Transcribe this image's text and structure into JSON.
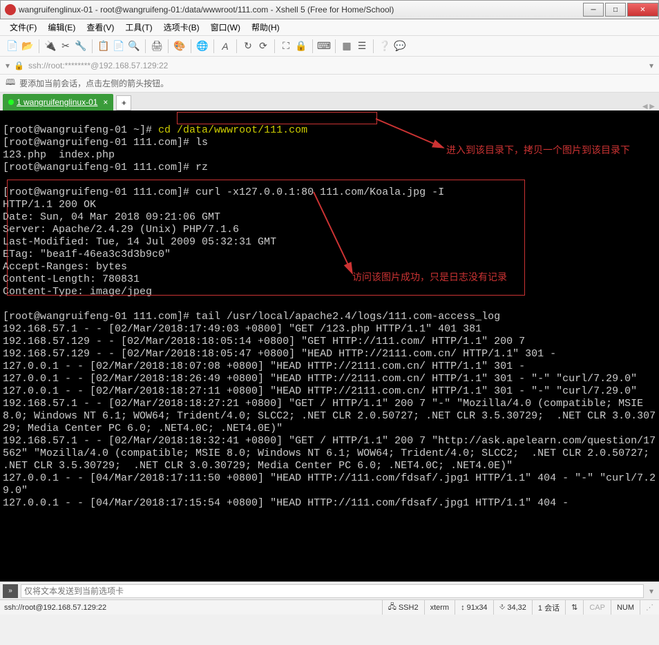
{
  "window": {
    "title": "wangruifenglinux-01 - root@wangruifeng-01:/data/wwwroot/111.com - Xshell 5 (Free for Home/School)"
  },
  "menu": {
    "file": "文件(F)",
    "edit": "编辑(E)",
    "view": "查看(V)",
    "tools": "工具(T)",
    "tabs": "选项卡(B)",
    "window": "窗口(W)",
    "help": "帮助(H)"
  },
  "address": {
    "value": "ssh://root:********@192.168.57.129:22"
  },
  "hint": "要添加当前会话，点击左侧的箭头按钮。",
  "tab": {
    "label": "1 wangruifenglinux-01"
  },
  "term": {
    "l1a": "[root@wangruifeng-01 ~]# ",
    "l1b": "cd /data/wwwroot/111.com",
    "l2": "[root@wangruifeng-01 111.com]# ls",
    "l3": "123.php  index.php",
    "l4": "[root@wangruifeng-01 111.com]# rz",
    "blank": "",
    "l6": "[root@wangruifeng-01 111.com]# curl -x127.0.0.1:80 111.com/Koala.jpg -I",
    "l7": "HTTP/1.1 200 OK",
    "l8": "Date: Sun, 04 Mar 2018 09:21:06 GMT",
    "l9": "Server: Apache/2.4.29 (Unix) PHP/7.1.6",
    "l10": "Last-Modified: Tue, 14 Jul 2009 05:32:31 GMT",
    "l11": "ETag: \"bea1f-46ea3c3d3b9c0\"",
    "l12": "Accept-Ranges: bytes",
    "l13": "Content-Length: 780831",
    "l14": "Content-Type: image/jpeg",
    "l16": "[root@wangruifeng-01 111.com]# tail /usr/local/apache2.4/logs/111.com-access_log",
    "l17": "192.168.57.1 - - [02/Mar/2018:17:49:03 +0800] \"GET /123.php HTTP/1.1\" 401 381",
    "l18": "192.168.57.129 - - [02/Mar/2018:18:05:14 +0800] \"GET HTTP://111.com/ HTTP/1.1\" 200 7",
    "l19": "192.168.57.129 - - [02/Mar/2018:18:05:47 +0800] \"HEAD HTTP://2111.com.cn/ HTTP/1.1\" 301 -",
    "l20": "127.0.0.1 - - [02/Mar/2018:18:07:08 +0800] \"HEAD HTTP://2111.com.cn/ HTTP/1.1\" 301 -",
    "l21": "127.0.0.1 - - [02/Mar/2018:18:26:49 +0800] \"HEAD HTTP://2111.com.cn/ HTTP/1.1\" 301 - \"-\" \"curl/7.29.0\"",
    "l22": "127.0.0.1 - - [02/Mar/2018:18:27:11 +0800] \"HEAD HTTP://2111.com.cn/ HTTP/1.1\" 301 - \"-\" \"curl/7.29.0\"",
    "l23": "192.168.57.1 - - [02/Mar/2018:18:27:21 +0800] \"GET / HTTP/1.1\" 200 7 \"-\" \"Mozilla/4.0 (compatible; MSIE 8.0; Windows NT 6.1; WOW64; Trident/4.0; SLCC2; .NET CLR 2.0.50727; .NET CLR 3.5.30729;  .NET CLR 3.0.30729; Media Center PC 6.0; .NET4.0C; .NET4.0E)\"",
    "l24": "192.168.57.1 - - [02/Mar/2018:18:32:41 +0800] \"GET / HTTP/1.1\" 200 7 \"http://ask.apelearn.com/question/17562\" \"Mozilla/4.0 (compatible; MSIE 8.0; Windows NT 6.1; WOW64; Trident/4.0; SLCC2;  .NET CLR 2.0.50727; .NET CLR 3.5.30729;  .NET CLR 3.0.30729; Media Center PC 6.0; .NET4.0C; .NET4.0E)\"",
    "l25": "127.0.0.1 - - [04/Mar/2018:17:11:50 +0800] \"HEAD HTTP://111.com/fdsaf/.jpg1 HTTP/1.1\" 404 - \"-\" \"curl/7.29.0\"",
    "l26": "127.0.0.1 - - [04/Mar/2018:17:15:54 +0800] \"HEAD HTTP://111.com/fdsaf/.jpg1 HTTP/1.1\" 404 -"
  },
  "annot": {
    "a1": "进入到该目录下，拷贝一个图片到该目录下",
    "a2": "访问该图片成功，只是日志没有记录"
  },
  "sendbar": {
    "placeholder": "仅将文本发送到当前选项卡"
  },
  "status": {
    "left": "ssh://root@192.168.57.129:22",
    "ssh": "SSH2",
    "term": "xterm",
    "size": "91x34",
    "pos": "34,32",
    "sess": "1 会话",
    "cap": "CAP",
    "num": "NUM"
  }
}
